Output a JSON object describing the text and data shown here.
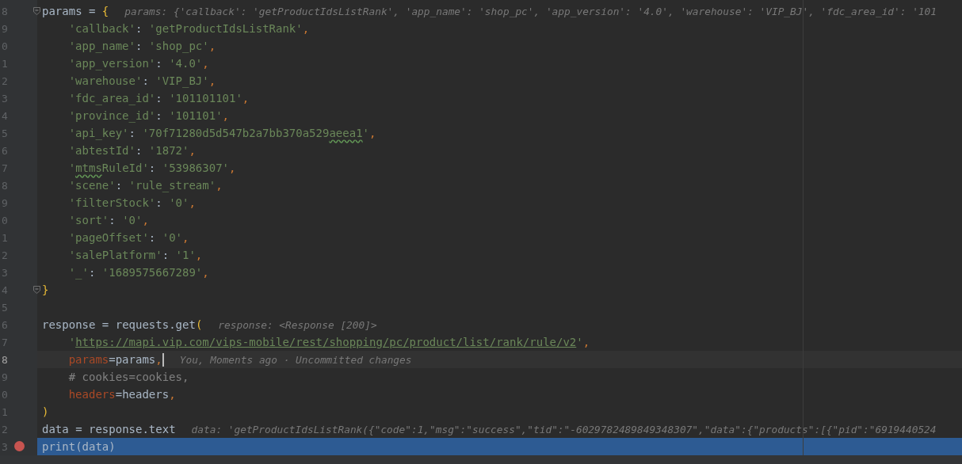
{
  "lines": [
    {
      "number": "8",
      "fold": true,
      "current": false,
      "execution": false,
      "breakpoint": false,
      "tokens": [
        {
          "kind": "plain",
          "text": "params = "
        },
        {
          "kind": "brace",
          "text": "{"
        }
      ],
      "hint": "params: {'callback': 'getProductIdsListRank', 'app_name': 'shop_pc', 'app_version': '4.0', 'warehouse': 'VIP_BJ', 'fdc_area_id': '101",
      "children": [
        {
          "number": "9",
          "fold": false,
          "current": false,
          "execution": false,
          "breakpoint": false,
          "tokens": [
            {
              "kind": "string",
              "text": "'callback'"
            },
            {
              "kind": "plain",
              "text": ": "
            },
            {
              "kind": "string",
              "text": "'getProductIdsListRank'"
            },
            {
              "kind": "comma",
              "text": ","
            }
          ]
        },
        {
          "number": "0",
          "fold": false,
          "current": false,
          "execution": false,
          "breakpoint": false,
          "tokens": [
            {
              "kind": "string",
              "text": "'app_name'"
            },
            {
              "kind": "plain",
              "text": ": "
            },
            {
              "kind": "string",
              "text": "'shop_pc'"
            },
            {
              "kind": "comma",
              "text": ","
            }
          ]
        },
        {
          "number": "1",
          "fold": false,
          "current": false,
          "execution": false,
          "breakpoint": false,
          "tokens": [
            {
              "kind": "string",
              "text": "'app_version'"
            },
            {
              "kind": "plain",
              "text": ": "
            },
            {
              "kind": "string",
              "text": "'4.0'"
            },
            {
              "kind": "comma",
              "text": ","
            }
          ]
        },
        {
          "number": "2",
          "fold": false,
          "current": false,
          "execution": false,
          "breakpoint": false,
          "tokens": [
            {
              "kind": "string",
              "text": "'warehouse'"
            },
            {
              "kind": "plain",
              "text": ": "
            },
            {
              "kind": "string",
              "text": "'VIP_BJ'"
            },
            {
              "kind": "comma",
              "text": ","
            }
          ]
        },
        {
          "number": "3",
          "fold": false,
          "current": false,
          "execution": false,
          "breakpoint": false,
          "tokens": [
            {
              "kind": "string",
              "text": "'fdc_area_id'"
            },
            {
              "kind": "plain",
              "text": ": "
            },
            {
              "kind": "string",
              "text": "'101101101'"
            },
            {
              "kind": "comma",
              "text": ","
            }
          ]
        },
        {
          "number": "4",
          "fold": false,
          "current": false,
          "execution": false,
          "breakpoint": false,
          "tokens": [
            {
              "kind": "string",
              "text": "'province_id'"
            },
            {
              "kind": "plain",
              "text": ": "
            },
            {
              "kind": "string",
              "text": "'101101'"
            },
            {
              "kind": "comma",
              "text": ","
            }
          ]
        },
        {
          "number": "5",
          "fold": false,
          "current": false,
          "execution": false,
          "breakpoint": false,
          "tokens": [
            {
              "kind": "string",
              "text": "'api_key'"
            },
            {
              "kind": "plain",
              "text": ": "
            },
            {
              "kind": "string",
              "text": "'70f71280d5d547b2a7bb370a529"
            },
            {
              "kind": "typo",
              "text": "aeea1"
            },
            {
              "kind": "string",
              "text": "'"
            },
            {
              "kind": "comma",
              "text": ","
            }
          ]
        },
        {
          "number": "6",
          "fold": false,
          "current": false,
          "execution": false,
          "breakpoint": false,
          "tokens": [
            {
              "kind": "string",
              "text": "'abtestId'"
            },
            {
              "kind": "plain",
              "text": ": "
            },
            {
              "kind": "string",
              "text": "'1872'"
            },
            {
              "kind": "comma",
              "text": ","
            }
          ]
        },
        {
          "number": "7",
          "fold": false,
          "current": false,
          "execution": false,
          "breakpoint": false,
          "tokens": [
            {
              "kind": "string",
              "text": "'"
            },
            {
              "kind": "typo",
              "text": "mtms"
            },
            {
              "kind": "string",
              "text": "RuleId'"
            },
            {
              "kind": "plain",
              "text": ": "
            },
            {
              "kind": "string",
              "text": "'53986307'"
            },
            {
              "kind": "comma",
              "text": ","
            }
          ]
        },
        {
          "number": "8",
          "fold": false,
          "current": false,
          "execution": false,
          "breakpoint": false,
          "tokens": [
            {
              "kind": "string",
              "text": "'scene'"
            },
            {
              "kind": "plain",
              "text": ": "
            },
            {
              "kind": "string",
              "text": "'rule_stream'"
            },
            {
              "kind": "comma",
              "text": ","
            }
          ]
        },
        {
          "number": "9",
          "fold": false,
          "current": false,
          "execution": false,
          "breakpoint": false,
          "tokens": [
            {
              "kind": "string",
              "text": "'filterStock'"
            },
            {
              "kind": "plain",
              "text": ": "
            },
            {
              "kind": "string",
              "text": "'0'"
            },
            {
              "kind": "comma",
              "text": ","
            }
          ]
        },
        {
          "number": "0",
          "fold": false,
          "current": false,
          "execution": false,
          "breakpoint": false,
          "tokens": [
            {
              "kind": "string",
              "text": "'sort'"
            },
            {
              "kind": "plain",
              "text": ": "
            },
            {
              "kind": "string",
              "text": "'0'"
            },
            {
              "kind": "comma",
              "text": ","
            }
          ]
        },
        {
          "number": "1",
          "fold": false,
          "current": false,
          "execution": false,
          "breakpoint": false,
          "tokens": [
            {
              "kind": "string",
              "text": "'pageOffset'"
            },
            {
              "kind": "plain",
              "text": ": "
            },
            {
              "kind": "string",
              "text": "'0'"
            },
            {
              "kind": "comma",
              "text": ","
            }
          ]
        },
        {
          "number": "2",
          "fold": false,
          "current": false,
          "execution": false,
          "breakpoint": false,
          "tokens": [
            {
              "kind": "string",
              "text": "'salePlatform'"
            },
            {
              "kind": "plain",
              "text": ": "
            },
            {
              "kind": "string",
              "text": "'1'"
            },
            {
              "kind": "comma",
              "text": ","
            }
          ]
        },
        {
          "number": "3",
          "fold": false,
          "current": false,
          "execution": false,
          "breakpoint": false,
          "tokens": [
            {
              "kind": "string",
              "text": "'_'"
            },
            {
              "kind": "plain",
              "text": ": "
            },
            {
              "kind": "string",
              "text": "'1689575667289'"
            },
            {
              "kind": "comma",
              "text": ","
            }
          ]
        }
      ]
    },
    {
      "number": "4",
      "fold": true,
      "current": false,
      "execution": false,
      "breakpoint": false,
      "tokens": [
        {
          "kind": "brace",
          "text": "}"
        }
      ]
    },
    {
      "number": "5",
      "fold": false,
      "current": false,
      "execution": false,
      "breakpoint": false
    },
    {
      "number": "6",
      "fold": false,
      "current": false,
      "execution": false,
      "breakpoint": false,
      "tokens": [
        {
          "kind": "plain",
          "text": "response = requests.get"
        },
        {
          "kind": "brace",
          "text": "("
        }
      ],
      "hint": "response: <Response [200]>",
      "children": [
        {
          "number": "7",
          "fold": false,
          "current": false,
          "execution": false,
          "breakpoint": false,
          "tokens": [
            {
              "kind": "string",
              "text": "'"
            },
            {
              "kind": "url",
              "text": "https://mapi.vip.com/vips-mobile/rest/shopping/pc/product/list/rank/rule/v2"
            },
            {
              "kind": "string",
              "text": "'"
            },
            {
              "kind": "comma",
              "text": ","
            }
          ]
        },
        {
          "number": "8",
          "fold": false,
          "current": true,
          "execution": false,
          "breakpoint": false,
          "tokens": [
            {
              "kind": "kwarg",
              "text": "params"
            },
            {
              "kind": "plain",
              "text": "=params"
            },
            {
              "kind": "comma",
              "text": ","
            }
          ],
          "hint": "You, Moments ago · Uncommitted changes"
        },
        {
          "number": "9",
          "fold": false,
          "current": false,
          "execution": false,
          "breakpoint": false,
          "tokens": [
            {
              "kind": "comment",
              "text": "# cookies=cookies,"
            }
          ]
        },
        {
          "number": "0",
          "fold": false,
          "current": false,
          "execution": false,
          "breakpoint": false,
          "tokens": [
            {
              "kind": "kwarg",
              "text": "headers"
            },
            {
              "kind": "plain",
              "text": "=headers"
            },
            {
              "kind": "comma",
              "text": ","
            }
          ]
        }
      ]
    },
    {
      "number": "1",
      "fold": false,
      "current": false,
      "execution": false,
      "breakpoint": false,
      "tokens": [
        {
          "kind": "brace",
          "text": ")"
        }
      ]
    },
    {
      "number": "2",
      "fold": false,
      "current": false,
      "execution": false,
      "breakpoint": false,
      "tokens": [
        {
          "kind": "plain",
          "text": "data = response.text"
        }
      ],
      "hint": "data: 'getProductIdsListRank({\"code\":1,\"msg\":\"success\",\"tid\":\"-6029782489849348307\",\"data\":{\"products\":[{\"pid\":\"6919440524"
    },
    {
      "number": "3",
      "fold": false,
      "current": false,
      "execution": true,
      "breakpoint": true,
      "tokens": [
        {
          "kind": "plain",
          "text": "print(data)"
        }
      ]
    }
  ]
}
